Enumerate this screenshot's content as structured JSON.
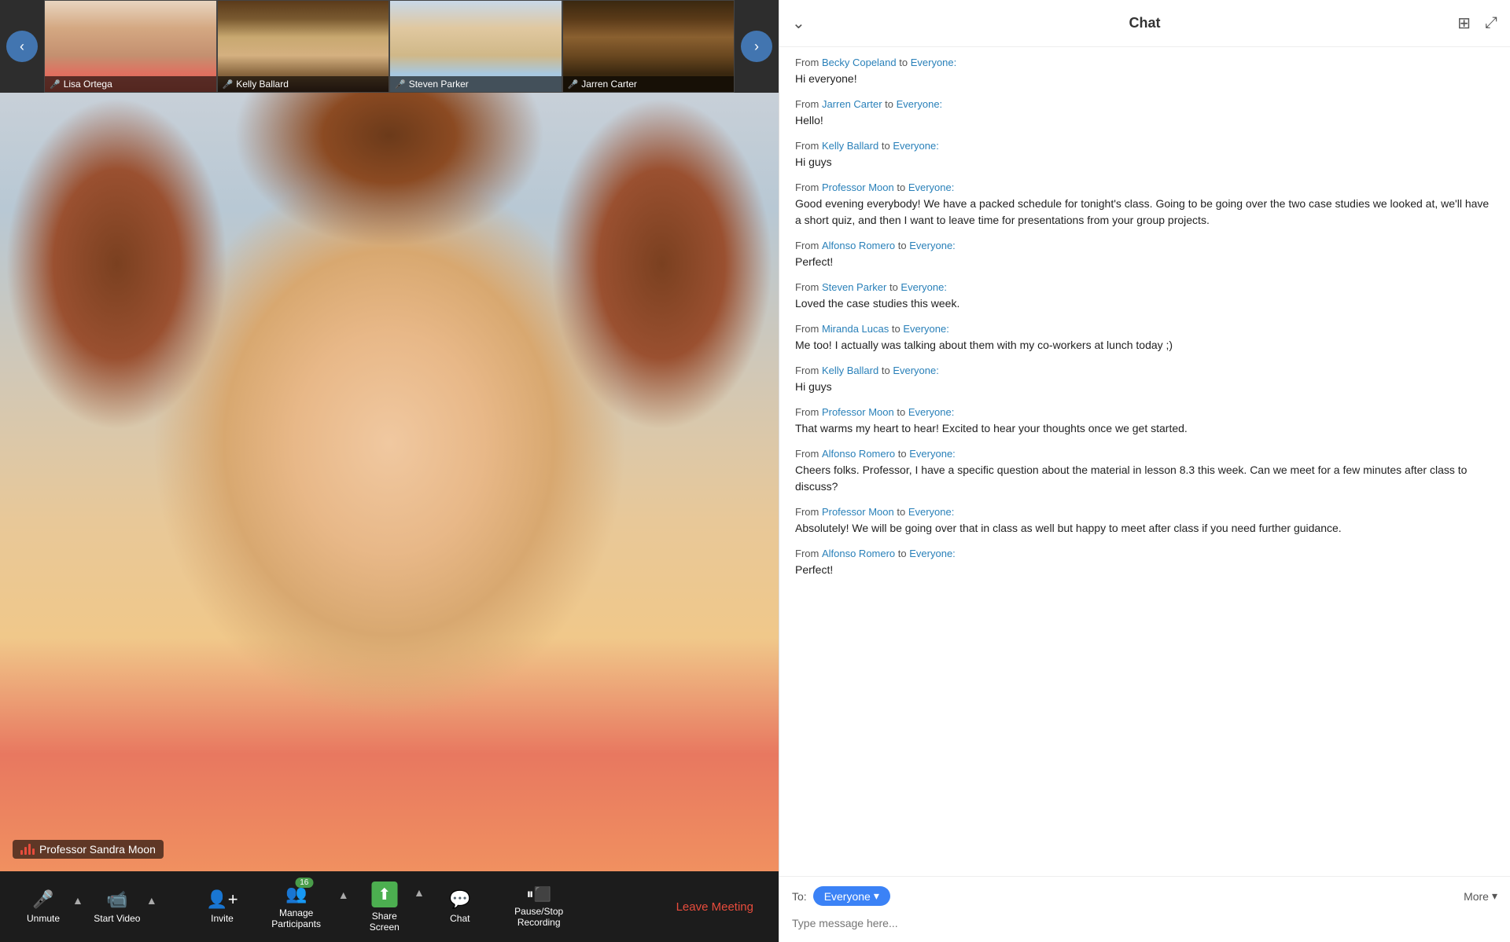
{
  "thumbnails": [
    {
      "name": "Lisa Ortega",
      "micOff": true,
      "colorClass": "photo-lisa"
    },
    {
      "name": "Kelly Ballard",
      "micOff": true,
      "colorClass": "photo-kelly"
    },
    {
      "name": "Steven Parker",
      "micOff": true,
      "colorClass": "photo-steven"
    },
    {
      "name": "Jarren Carter",
      "micOff": true,
      "colorClass": "photo-jarren"
    }
  ],
  "mainSpeaker": "Professor Sandra Moon",
  "toolbar": {
    "unmute_label": "Unmute",
    "start_video_label": "Start Video",
    "invite_label": "Invite",
    "manage_participants_label": "Manage Participants",
    "participants_count": "16",
    "share_screen_label": "Share Screen",
    "chat_label": "Chat",
    "recording_label": "Pause/Stop Recording",
    "leave_label": "Leave Meeting"
  },
  "chat": {
    "title": "Chat",
    "messages": [
      {
        "sender": "Becky Copeland",
        "recipient": "Everyone",
        "body": "Hi everyone!"
      },
      {
        "sender": "Jarren Carter",
        "recipient": "Everyone",
        "body": "Hello!"
      },
      {
        "sender": "Kelly Ballard",
        "recipient": "Everyone",
        "body": "Hi guys"
      },
      {
        "sender": "Professor Moon",
        "recipient": "Everyone",
        "body": "Good evening everybody! We have a packed schedule for tonight's class. Going to be going over the two case studies we looked at, we'll have a short quiz, and then I want to leave time for presentations from your group projects."
      },
      {
        "sender": "Alfonso Romero",
        "recipient": "Everyone",
        "body": "Perfect!"
      },
      {
        "sender": "Steven Parker",
        "recipient": "Everyone",
        "body": "Loved the case studies this week."
      },
      {
        "sender": "Miranda Lucas",
        "recipient": "Everyone",
        "body": "Me too! I actually was talking about them with my co-workers at lunch today ;)"
      },
      {
        "sender": "Kelly Ballard",
        "recipient": "Everyone",
        "body": "Hi guys"
      },
      {
        "sender": "Professor Moon",
        "recipient": "Everyone",
        "body": "That warms my heart to hear! Excited to hear your thoughts once we get started."
      },
      {
        "sender": "Alfonso Romero",
        "recipient": "Everyone",
        "body": "Cheers folks. Professor, I have a specific question about the material in lesson 8.3 this week. Can we meet for a few minutes after class to discuss?"
      },
      {
        "sender": "Professor Moon",
        "recipient": "Everyone",
        "body": "Absolutely! We will be going over that in class as well but happy to meet after class if you need further guidance."
      },
      {
        "sender": "Alfonso Romero",
        "recipient": "Everyone",
        "body": "Perfect!"
      }
    ],
    "to_label": "To:",
    "recipient_label": "Everyone",
    "more_label": "More",
    "input_placeholder": "Type message here...",
    "chevron": "▾"
  }
}
